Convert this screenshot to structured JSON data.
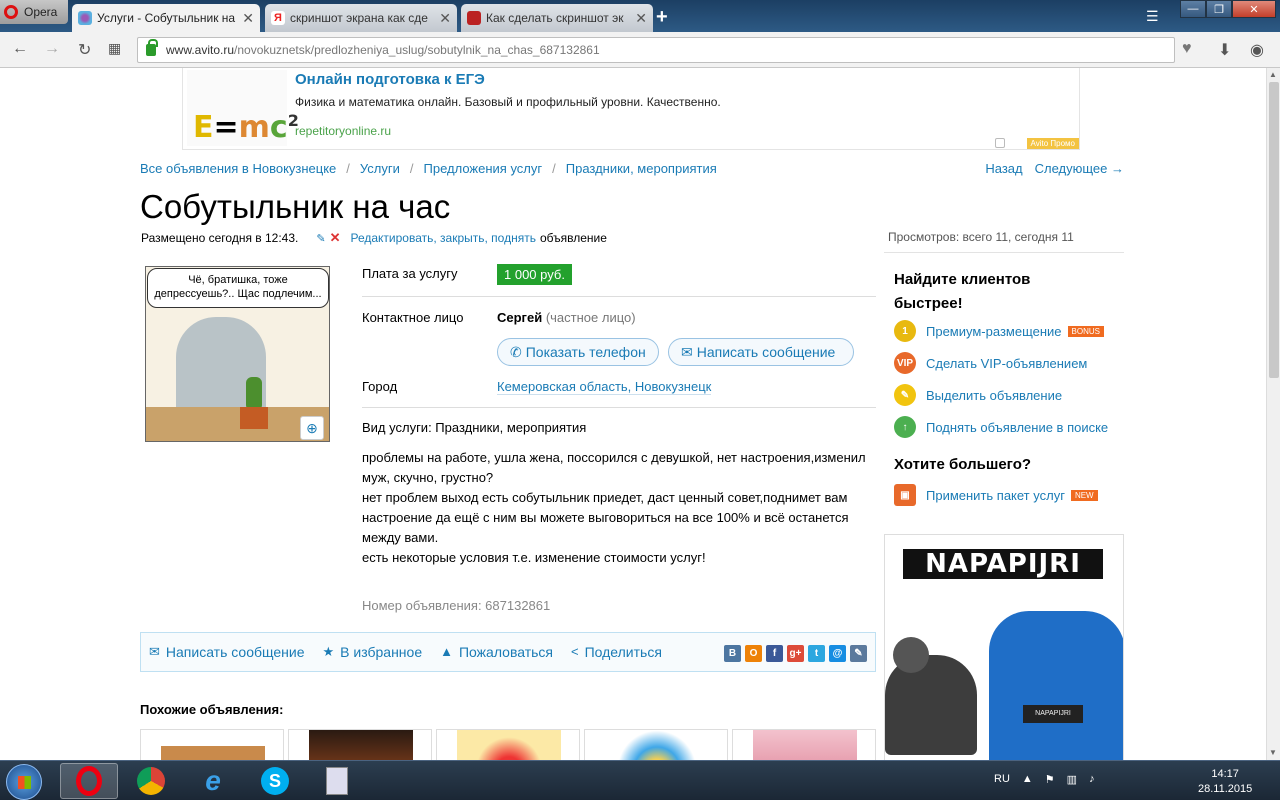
{
  "browser": {
    "menu_label": "Opera",
    "tabs": [
      {
        "title": "Услуги - Собутыльник на",
        "active": true
      },
      {
        "title": "скриншот экрана как сде",
        "active": false
      },
      {
        "title": "Как сделать скриншот эк",
        "active": false
      }
    ],
    "url_host": "www.avito.ru",
    "url_path": "/novokuznetsk/predlozheniya_uslug/sobutylnik_na_chas_687132861"
  },
  "banner": {
    "formula": "E=mc",
    "title": "Онлайн подготовка к ЕГЭ",
    "text": "Физика и математика онлайн. Базовый и профильный уровни. Качественно.",
    "url": "repetitoryonline.ru",
    "promo_label": "Avito Промо"
  },
  "breadcrumb": [
    "Все объявления в Новокузнецке",
    "Услуги",
    "Предложения услуг",
    "Праздники, мероприятия"
  ],
  "topnav": {
    "back": "Назад",
    "next": "Следующее →"
  },
  "listing": {
    "title": "Собутыльник на час",
    "posted": "Размещено сегодня в 12:43.",
    "edit_links": "Редактировать, закрыть, поднять",
    "edit_suffix": "объявление",
    "views": "Просмотров: всего 11, сегодня 11",
    "image_caption": "Чё, братишка, тоже депрессуешь?.. Щас подлечим...",
    "price_label": "Плата за услугу",
    "price": "1 000 руб.",
    "contact_label": "Контактное лицо",
    "contact_name": "Сергей",
    "contact_type": "(частное лицо)",
    "show_phone": "Показать телефон",
    "write_message": "Написать сообщение",
    "city_label": "Город",
    "city": "Кемеровская область, Новокузнецк",
    "service_type": "Вид услуги: Праздники, мероприятия",
    "description": [
      "проблемы на работе, ушла жена, поссорился с девушкой, нет настроения,изменил муж, скучно, грустно?",
      "нет проблем выход есть собутыльник приедет, даст ценный совет,поднимет вам настроение да ещё с ним вы можете выговориться на все 100% и всё останется между вами.",
      "есть некоторые условия т.е. изменение стоимости услуг!"
    ],
    "ad_number": "Номер объявления: 687132861"
  },
  "action_bar": {
    "message": "Написать сообщение",
    "favorite": "В избранное",
    "complain": "Пожаловаться",
    "share": "Поделиться"
  },
  "share_icons": [
    {
      "label": "В",
      "color": "#4d76a1"
    },
    {
      "label": "О",
      "color": "#ee8208"
    },
    {
      "label": "f",
      "color": "#3b5998"
    },
    {
      "label": "g+",
      "color": "#dd4b39"
    },
    {
      "label": "t",
      "color": "#2ca7e0"
    },
    {
      "label": "@",
      "color": "#168de2"
    },
    {
      "label": "✎",
      "color": "#5b7a9d"
    }
  ],
  "similar": {
    "title": "Похожие объявления:"
  },
  "sidebar": {
    "promo_title": "Найдите клиентов быстрее!",
    "items": [
      {
        "label": "Премиум-размещение",
        "tag": "BONUS",
        "icon": "premium-coin-icon",
        "color": "#e8b90f",
        "glyph": "1"
      },
      {
        "label": "Сделать VIP-объявлением",
        "tag": "",
        "icon": "vip-icon",
        "color": "#e8692a",
        "glyph": "VIP"
      },
      {
        "label": "Выделить объявление",
        "tag": "",
        "icon": "highlighter-icon",
        "color": "#f1c40f",
        "glyph": "✎"
      },
      {
        "label": "Поднять объявление в поиске",
        "tag": "",
        "icon": "raise-arrow-icon",
        "color": "#4caf50",
        "glyph": "↑"
      }
    ],
    "more_title": "Хотите большего?",
    "package": {
      "label": "Применить пакет услуг",
      "tag": "NEW"
    },
    "side_ad_logo": "NAPAPIJRI"
  },
  "taskbar": {
    "lang": "RU",
    "time": "14:17",
    "date": "28.11.2015"
  }
}
